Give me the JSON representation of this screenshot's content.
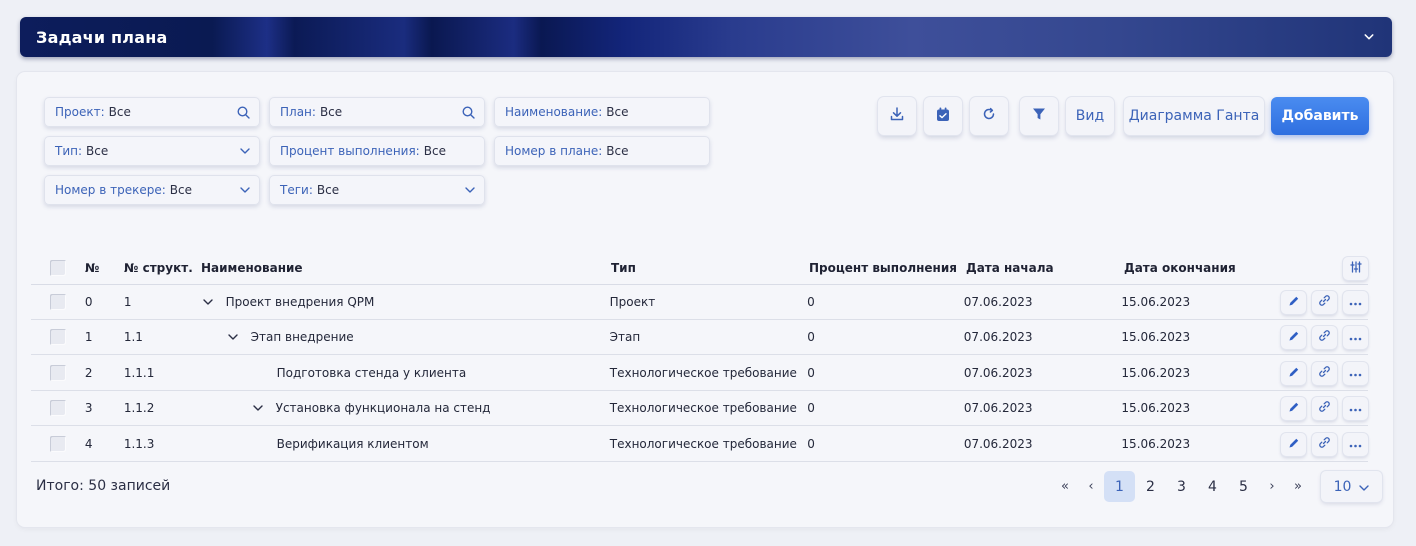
{
  "header": {
    "title": "Задачи плана"
  },
  "filters": [
    {
      "label": "Проект:",
      "value": "Все",
      "icon": "search-icon"
    },
    {
      "label": "План:",
      "value": "Все",
      "icon": "search-icon"
    },
    {
      "label": "Наименование:",
      "value": "Все",
      "icon": ""
    },
    {
      "label": "Тип:",
      "value": "Все",
      "icon": "chevron-down-icon"
    },
    {
      "label": "Процент выполнения:",
      "value": "Все",
      "icon": ""
    },
    {
      "label": "Номер в плане:",
      "value": "Все",
      "icon": ""
    },
    {
      "label": "Номер в трекере:",
      "value": "Все",
      "icon": "chevron-down-icon"
    },
    {
      "label": "Теги:",
      "value": "Все",
      "icon": "chevron-down-icon"
    }
  ],
  "toolbar": {
    "view_label": "Вид",
    "gantt_label": "Диаграмма Ганта",
    "add_label": "Добавить"
  },
  "table": {
    "headers": {
      "no": "№",
      "struct": "№ структ.",
      "name": "Наименование",
      "type": "Тип",
      "percent": "Процент выполнения",
      "start": "Дата начала",
      "end": "Дата окончания"
    },
    "rows": [
      {
        "no": "0",
        "struct": "1",
        "name": "Проект внедрения QPM",
        "type": "Проект",
        "percent": "0",
        "start": "07.06.2023",
        "end": "15.06.2023"
      },
      {
        "no": "1",
        "struct": "1.1",
        "name": "Этап внедрение",
        "type": "Этап",
        "percent": "0",
        "start": "07.06.2023",
        "end": "15.06.2023"
      },
      {
        "no": "2",
        "struct": "1.1.1",
        "name": "Подготовка стенда у клиента",
        "type": "Технологическое требование",
        "percent": "0",
        "start": "07.06.2023",
        "end": "15.06.2023"
      },
      {
        "no": "3",
        "struct": "1.1.2",
        "name": "Установка функционала на стенд",
        "type": "Технологическое требование",
        "percent": "0",
        "start": "07.06.2023",
        "end": "15.06.2023"
      },
      {
        "no": "4",
        "struct": "1.1.3",
        "name": "Верификация клиентом",
        "type": "Технологическое требование",
        "percent": "0",
        "start": "07.06.2023",
        "end": "15.06.2023"
      }
    ]
  },
  "footer": {
    "total": "Итого: 50 записей",
    "pages": [
      "1",
      "2",
      "3",
      "4",
      "5"
    ],
    "first": "«",
    "prev": "‹",
    "next": "›",
    "last": "»",
    "page_size": "10"
  },
  "colors": {
    "accent": "#3c63b8",
    "header_bg": "#0d1d5c",
    "add_button": "#2f6fe0",
    "active_page": "#d4e0f6"
  }
}
